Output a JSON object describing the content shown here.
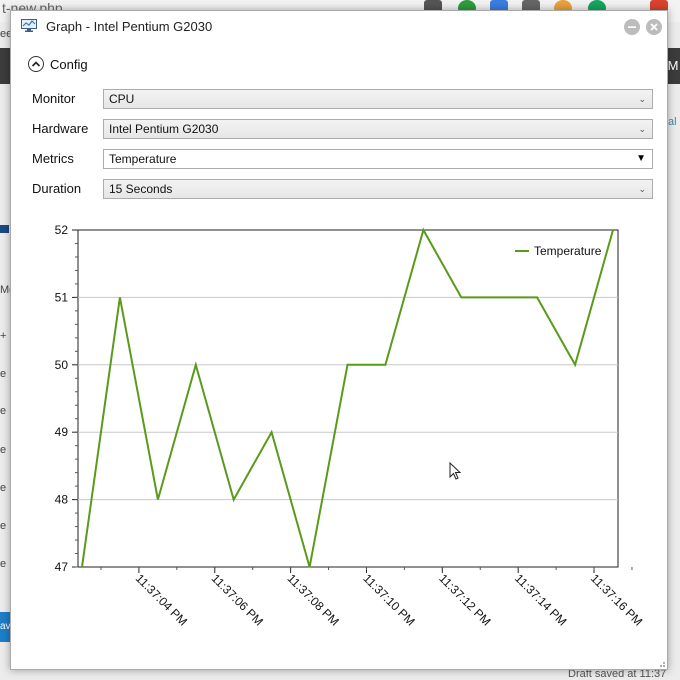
{
  "background": {
    "url_fragment": "t-new.php",
    "left_fragments": [
      "ee",
      "Mo",
      "+",
      "e",
      "e",
      "e",
      "e",
      "e",
      "e",
      "av"
    ],
    "right_fragment": "M",
    "right_side_fragment": "al",
    "footer_status": "Draft saved at 11:37"
  },
  "window": {
    "title": "Graph - Intel Pentium G2030",
    "icon": "monitor-graph-icon",
    "minimize_icon": "minimize-icon",
    "close_icon": "close-icon"
  },
  "config": {
    "label": "Config",
    "icon": "chevron-up-circle-icon",
    "fields": [
      {
        "label": "Monitor",
        "value": "CPU"
      },
      {
        "label": "Hardware",
        "value": "Intel Pentium G2030"
      },
      {
        "label": "Metrics",
        "value": "Temperature"
      },
      {
        "label": "Duration",
        "value": "15 Seconds"
      }
    ]
  },
  "chart_data": {
    "type": "line",
    "ylim": [
      47,
      52
    ],
    "yticks": [
      47,
      48,
      49,
      50,
      51,
      52
    ],
    "grid": true,
    "legend": "top-right",
    "x_tick_labels": [
      "11:37:04 PM",
      "11:37:06 PM",
      "11:37:08 PM",
      "11:37:10 PM",
      "11:37:12 PM",
      "11:37:14 PM",
      "11:37:16 PM"
    ],
    "x": [
      "11:37:02.5 PM",
      "11:37:03.5 PM",
      "11:37:04.5 PM",
      "11:37:05.6 PM",
      "11:37:06.6 PM",
      "11:37:07.6 PM",
      "11:37:08.6 PM",
      "11:37:09.6 PM",
      "11:37:10.6 PM",
      "11:37:11.6 PM",
      "11:37:12.6 PM",
      "11:37:13.6 PM",
      "11:37:14.6 PM",
      "11:37:15.6 PM",
      "11:37:16.5 PM"
    ],
    "series": [
      {
        "name": "Temperature",
        "color": "#5a9a1a",
        "values": [
          47,
          51,
          48,
          50,
          48,
          49,
          47,
          50,
          50,
          52,
          51,
          51,
          51,
          50,
          52
        ]
      }
    ]
  }
}
